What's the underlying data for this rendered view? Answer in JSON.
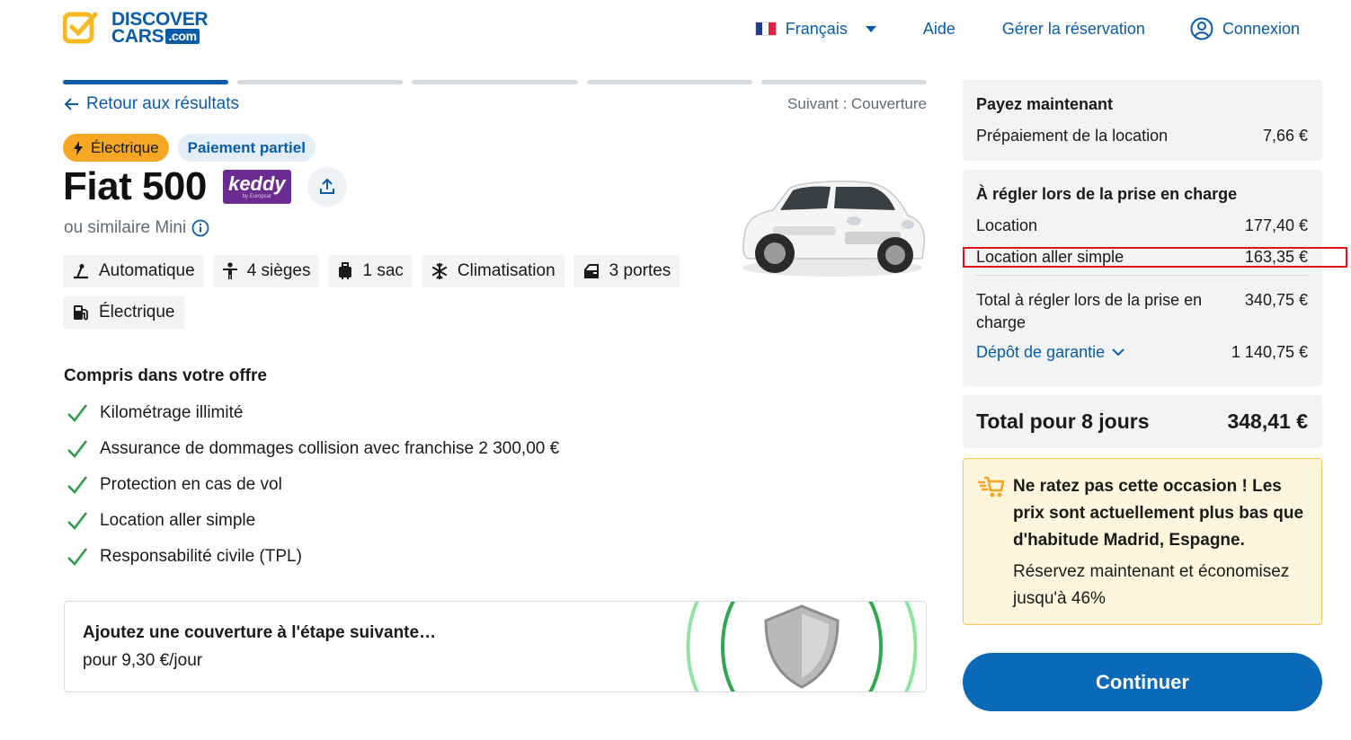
{
  "header": {
    "logo_line1": "DISCOVER",
    "logo_line2": "CARS",
    "logo_suffix": ".com",
    "language": "Français",
    "help": "Aide",
    "manage": "Gérer la réservation",
    "login": "Connexion"
  },
  "progress": {
    "total_steps": 5,
    "current_step": 1
  },
  "nav": {
    "back": "Retour aux résultats",
    "next": "Suivant : Couverture"
  },
  "car": {
    "badges": [
      "Électrique",
      "Paiement partiel"
    ],
    "title": "Fiat 500",
    "supplier": "keddy",
    "supplier_sub": "by Europcar",
    "similar": "ou similaire Mini",
    "features": [
      {
        "icon": "transmission-icon",
        "label": "Automatique"
      },
      {
        "icon": "person-icon",
        "label": "4 sièges"
      },
      {
        "icon": "luggage-icon",
        "label": "1 sac"
      },
      {
        "icon": "snowflake-icon",
        "label": "Climatisation"
      },
      {
        "icon": "car-door-icon",
        "label": "3 portes"
      },
      {
        "icon": "fuel-pump-icon",
        "label": "Électrique"
      }
    ]
  },
  "included": {
    "title": "Compris dans votre offre",
    "items": [
      "Kilométrage illimité",
      "Assurance de dommages collision avec franchise 2 300,00 €",
      "Protection en cas de vol",
      "Location aller simple",
      "Responsabilité civile (TPL)"
    ]
  },
  "coverage": {
    "title": "Ajoutez une couverture à l'étape suivante…",
    "price": "pour 9,30 €/jour"
  },
  "pay_now": {
    "title": "Payez maintenant",
    "label": "Prépaiement de la location",
    "value": "7,66 €"
  },
  "pickup": {
    "title": "À régler lors de la prise en charge",
    "rows": [
      {
        "label": "Location",
        "value": "177,40 €"
      },
      {
        "label": "Location aller simple",
        "value": "163,35 €"
      }
    ],
    "total_label": "Total à régler lors de la prise en charge",
    "total_value": "340,75 €",
    "deposit_label": "Dépôt de garantie",
    "deposit_value": "1 140,75 €"
  },
  "total": {
    "label": "Total pour 8 jours",
    "value": "348,41 €"
  },
  "deal": {
    "title": "Ne ratez pas cette occasion ! Les prix sont actuellement plus bas que d'habitude Madrid, Espagne.",
    "desc": "Réservez maintenant et économisez jusqu'à 46%"
  },
  "continue_label": "Continuer",
  "colors": {
    "brand": "#0a5ca8",
    "accent": "#f5a623",
    "success": "#2e9e4a",
    "highlight": "#e0141a"
  }
}
